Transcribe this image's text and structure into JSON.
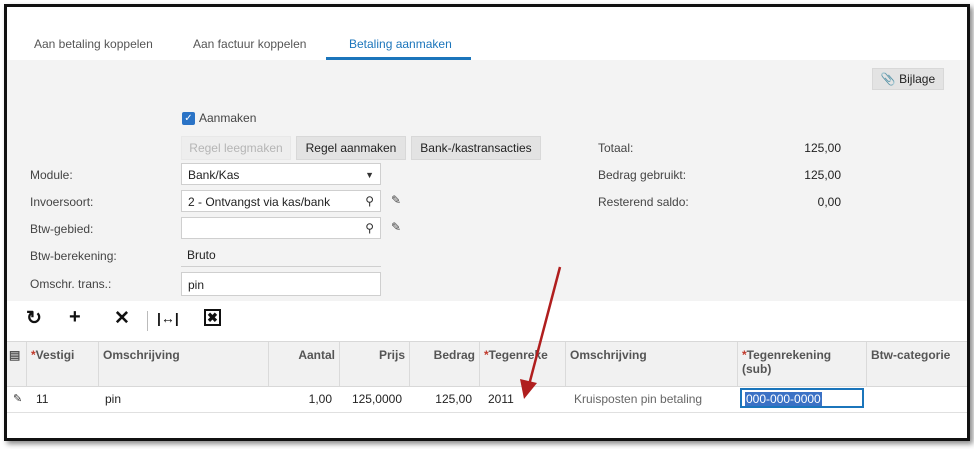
{
  "tabs": [
    "Aan betaling koppelen",
    "Aan factuur koppelen",
    "Betaling aanmaken"
  ],
  "attachment_label": "Bijlage",
  "create_checkbox_label": "Aanmaken",
  "buttons": {
    "clear_line": "Regel leegmaken",
    "create_line": "Regel aanmaken",
    "bank_transactions": "Bank-/kastransacties"
  },
  "form": {
    "module_label": "Module:",
    "module_value": "Bank/Kas",
    "entry_type_label": "Invoersoort:",
    "entry_type_value": "2 - Ontvangst via kas/bank",
    "vat_area_label": "Btw-gebied:",
    "vat_area_value": "",
    "vat_calc_label": "Btw-berekening:",
    "vat_calc_value": "Bruto",
    "desc_label": "Omschr. trans.:",
    "desc_value": "pin"
  },
  "totals": {
    "total_label": "Totaal:",
    "total_value": "125,00",
    "used_label": "Bedrag gebruikt:",
    "used_value": "125,00",
    "remaining_label": "Resterend saldo:",
    "remaining_value": "0,00"
  },
  "toolbar_icons": [
    "refresh-icon",
    "add-icon",
    "delete-icon",
    "fit-columns-icon",
    "export-excel-icon"
  ],
  "grid": {
    "headers": {
      "branch": "Vestigi",
      "description": "Omschrijving",
      "quantity": "Aantal",
      "price": "Prijs",
      "amount": "Bedrag",
      "offset_account": "Tegenreke",
      "description2": "Omschrijving",
      "offset_sub": "Tegenrekening (sub)",
      "vat_category": "Btw-categorie"
    },
    "required_marker": "*",
    "rows": [
      {
        "branch": "11",
        "description": "pin",
        "quantity": "1,00",
        "price": "125,0000",
        "amount": "125,00",
        "offset_account": "2011",
        "description2": "Kruisposten pin betaling",
        "offset_sub": "000-000-0000",
        "vat_category": ""
      }
    ]
  },
  "annotation_color": "#b01e1e",
  "accent_color": "#1b75bb"
}
